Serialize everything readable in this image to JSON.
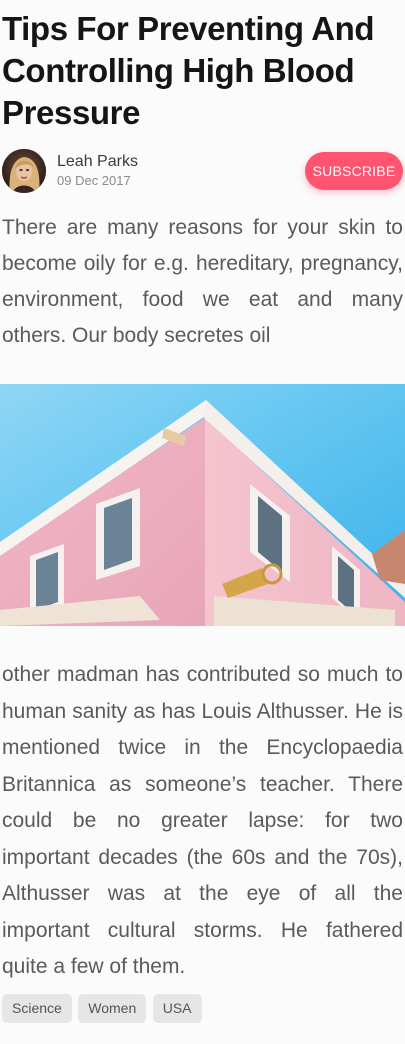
{
  "article": {
    "title": "Tips For Preventing And Controlling High Blood Pressure",
    "author": {
      "name": "Leah Parks",
      "date": "09 Dec 2017",
      "avatar_icon": "user-avatar"
    },
    "subscribe_label": "SUBSCRIBE",
    "intro": "There are many reasons for your skin to become oily for e.g. hereditary, pregnancy, environment, food we eat and many others. Our body secretes oil",
    "hero_image": "pink-building-photo",
    "body": "other madman has contributed so much to human sanity as has Louis Althusser. He is mentioned twice in the Encyclopaedia Britannica as someone’s teacher. There could be no greater lapse: for two important decades (the 60s and the 70s), Althusser was at the eye of all the important cultural storms. He fathered quite a few of them.",
    "tags": [
      "Science",
      "Women",
      "USA"
    ]
  },
  "colors": {
    "accent": "#ff5470",
    "background": "#fbfbfb",
    "text": "#5a5a5a",
    "tag_bg": "#e6e6e6"
  }
}
